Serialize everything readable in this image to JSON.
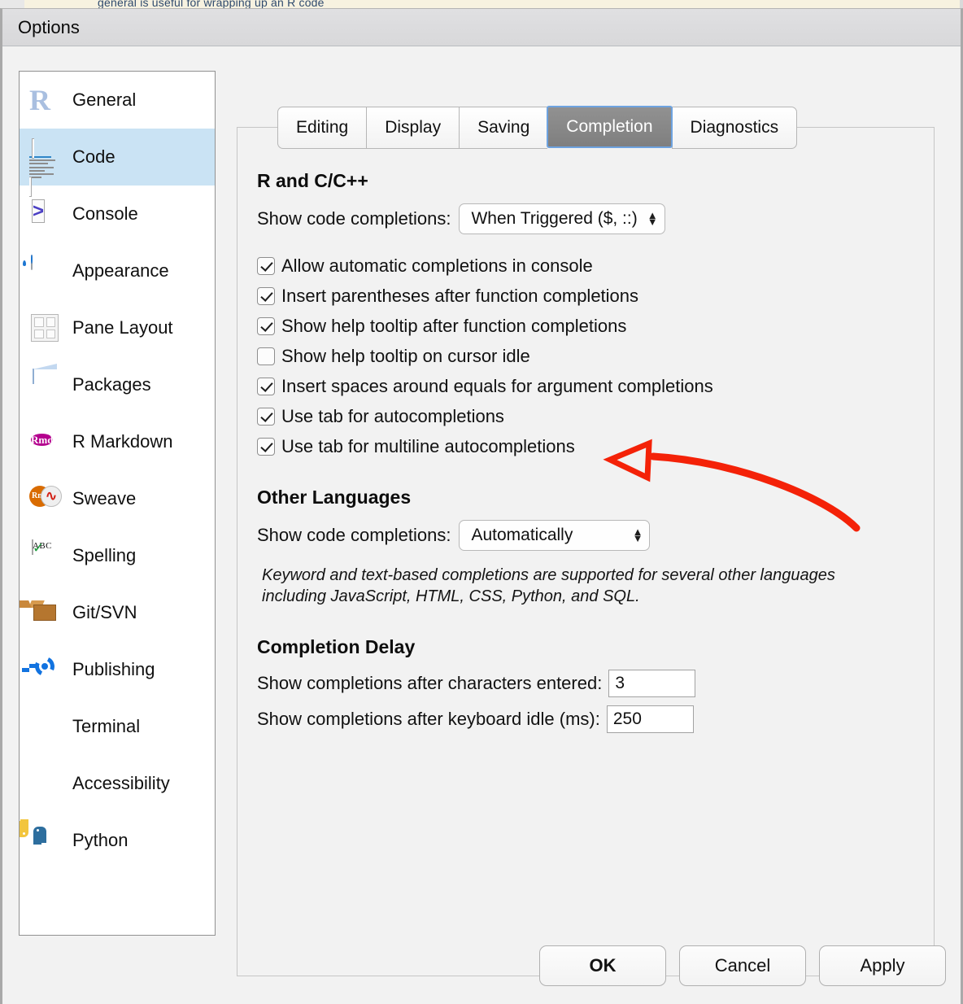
{
  "background_sliver": {
    "text": "general is useful for wrapping up an R code"
  },
  "window": {
    "title": "Options"
  },
  "sidebar": {
    "items": [
      {
        "label": "General",
        "icon": "r-logo-icon",
        "selected": false
      },
      {
        "label": "Code",
        "icon": "code-document-icon",
        "selected": true
      },
      {
        "label": "Console",
        "icon": "console-prompt-icon",
        "selected": false
      },
      {
        "label": "Appearance",
        "icon": "paint-can-icon",
        "selected": false
      },
      {
        "label": "Pane Layout",
        "icon": "pane-grid-icon",
        "selected": false
      },
      {
        "label": "Packages",
        "icon": "package-box-icon",
        "selected": false
      },
      {
        "label": "R Markdown",
        "icon": "rmd-badge-icon",
        "selected": false
      },
      {
        "label": "Sweave",
        "icon": "sweave-rnw-pdf-icon",
        "selected": false
      },
      {
        "label": "Spelling",
        "icon": "abc-checkmark-icon",
        "selected": false
      },
      {
        "label": "Git/SVN",
        "icon": "open-box-icon",
        "selected": false
      },
      {
        "label": "Publishing",
        "icon": "publish-ring-icon",
        "selected": false
      },
      {
        "label": "Terminal",
        "icon": "terminal-square-icon",
        "selected": false
      },
      {
        "label": "Accessibility",
        "icon": "accessibility-icon",
        "selected": false
      },
      {
        "label": "Python",
        "icon": "python-logo-icon",
        "selected": false
      }
    ]
  },
  "tabs": [
    {
      "label": "Editing",
      "active": false
    },
    {
      "label": "Display",
      "active": false
    },
    {
      "label": "Saving",
      "active": false
    },
    {
      "label": "Completion",
      "active": true
    },
    {
      "label": "Diagnostics",
      "active": false
    }
  ],
  "sections": {
    "r_cpp": {
      "heading": "R and C/C++",
      "show_completions_label": "Show code completions:",
      "show_completions_value": "When Triggered ($, ::)",
      "checkboxes": [
        {
          "label": "Allow automatic completions in console",
          "checked": true
        },
        {
          "label": "Insert parentheses after function completions",
          "checked": true
        },
        {
          "label": "Show help tooltip after function completions",
          "checked": true
        },
        {
          "label": "Show help tooltip on cursor idle",
          "checked": false
        },
        {
          "label": "Insert spaces around equals for argument completions",
          "checked": true
        },
        {
          "label": "Use tab for autocompletions",
          "checked": true
        },
        {
          "label": "Use tab for multiline autocompletions",
          "checked": true
        }
      ]
    },
    "other_languages": {
      "heading": "Other Languages",
      "show_completions_label": "Show code completions:",
      "show_completions_value": "Automatically",
      "note": "Keyword and text-based completions are supported for several other languages including JavaScript, HTML, CSS, Python, and SQL."
    },
    "completion_delay": {
      "heading": "Completion Delay",
      "chars_label": "Show completions after characters entered:",
      "chars_value": "3",
      "idle_label": "Show completions after keyboard idle (ms):",
      "idle_value": "250"
    }
  },
  "annotation": {
    "type": "curved-arrow",
    "color": "#f42208",
    "points_at": "Use tab for autocompletions / Use tab for multiline autocompletions"
  },
  "footer": {
    "ok_label": "OK",
    "cancel_label": "Cancel",
    "apply_label": "Apply"
  },
  "colors": {
    "selection_blue": "#cae3f4",
    "active_tab_bg": "#858585",
    "active_tab_border": "#6ea3e0",
    "dialog_bg": "#f2f2f2",
    "annotation_red": "#f42208"
  }
}
